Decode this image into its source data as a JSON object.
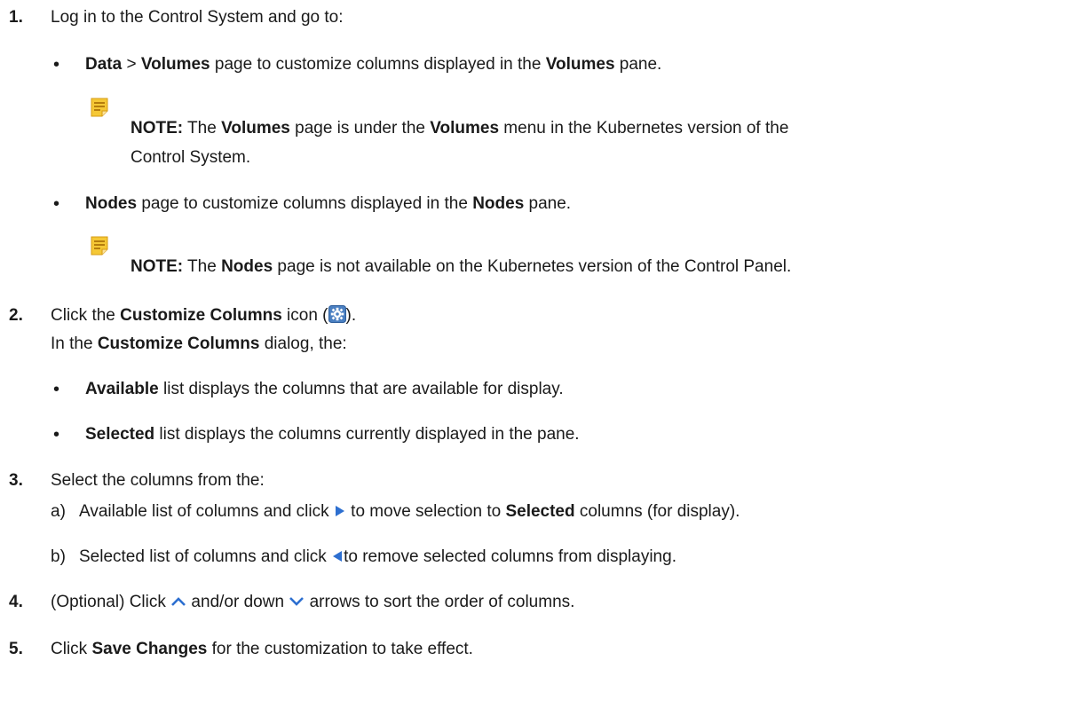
{
  "steps": {
    "s1": {
      "num": "1.",
      "text": "Log in to the Control System and go to:",
      "b1": {
        "a": "Data",
        "b": " > ",
        "c": "Volumes",
        "d": " page to customize columns displayed in the ",
        "e": "Volumes",
        "f": " pane."
      },
      "note1": {
        "label": "NOTE:",
        "a": " The ",
        "b": "Volumes",
        "c": " page is under the ",
        "d": "Volumes",
        "e": " menu in the Kubernetes version of the",
        "line2": "Control System."
      },
      "b2": {
        "a": "Nodes",
        "b": " page to customize columns displayed in the ",
        "c": "Nodes",
        "d": " pane."
      },
      "note2": {
        "label": "NOTE:",
        "a": " The ",
        "b": "Nodes",
        "c": " page is not available on the Kubernetes version of the Control Panel."
      }
    },
    "s2": {
      "num": "2.",
      "a": "Click the ",
      "b": "Customize Columns",
      "c": " icon (",
      "d": ").",
      "line2": {
        "a": "In the ",
        "b": "Customize Columns",
        "c": " dialog, the:"
      },
      "b1": {
        "a": "Available",
        "b": " list displays the columns that are available for display."
      },
      "b2": {
        "a": "Selected",
        "b": " list displays the columns currently displayed in the pane."
      }
    },
    "s3": {
      "num": "3.",
      "text": "Select the columns from the:",
      "a": {
        "label": "a)",
        "t1": "Available list of columns and click ",
        "t2": " to move selection to ",
        "t3": "Selected",
        "t4": " columns (for display)."
      },
      "b": {
        "label": "b)",
        "t1": "Selected list of columns and click ",
        "t2": "to remove selected columns from displaying."
      }
    },
    "s4": {
      "num": "4.",
      "a": "(Optional) Click ",
      "b": " and/or down ",
      "c": " arrows to sort the order of columns."
    },
    "s5": {
      "num": "5.",
      "a": "Click ",
      "b": "Save Changes",
      "c": " for the customization to take effect."
    }
  },
  "bullet": "•",
  "icons": {
    "note": "note-icon",
    "gear": "gear-icon",
    "right": "triangle-right-icon",
    "left": "triangle-left-icon",
    "up": "chevron-up-icon",
    "down": "chevron-down-icon"
  },
  "colors": {
    "note_icon": "#e8b91f",
    "gear_icon": "#4a7fc1",
    "triangle": "#2d6fd0",
    "chevron": "#2d6fd0"
  }
}
